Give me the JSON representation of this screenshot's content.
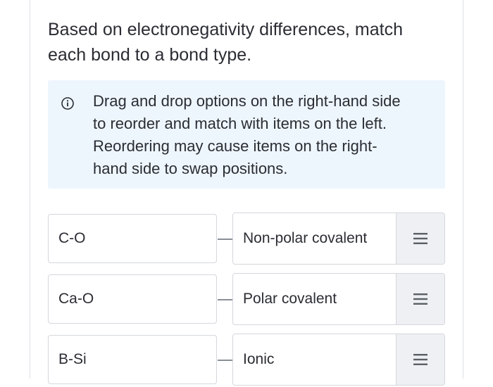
{
  "question": {
    "line1": "Based on electronegativity differences, match",
    "line2": "each bond to a bond type."
  },
  "info": {
    "icon": "info-circle-icon",
    "line1": "Drag and drop options on the right-hand side",
    "line2": "to reorder and match with items on the left.",
    "line3": "Reordering may cause items on the right-",
    "line4": "hand side to swap positions."
  },
  "matches": [
    {
      "left": "C-O",
      "right": "Non-polar covalent"
    },
    {
      "left": "Ca-O",
      "right": "Polar covalent"
    },
    {
      "left": "B-Si",
      "right": "Ionic"
    }
  ],
  "colors": {
    "info_bg": "#eef6fd",
    "text": "#2a2d33",
    "border": "#d4d7dc",
    "handle_bg": "#eef0f3"
  }
}
